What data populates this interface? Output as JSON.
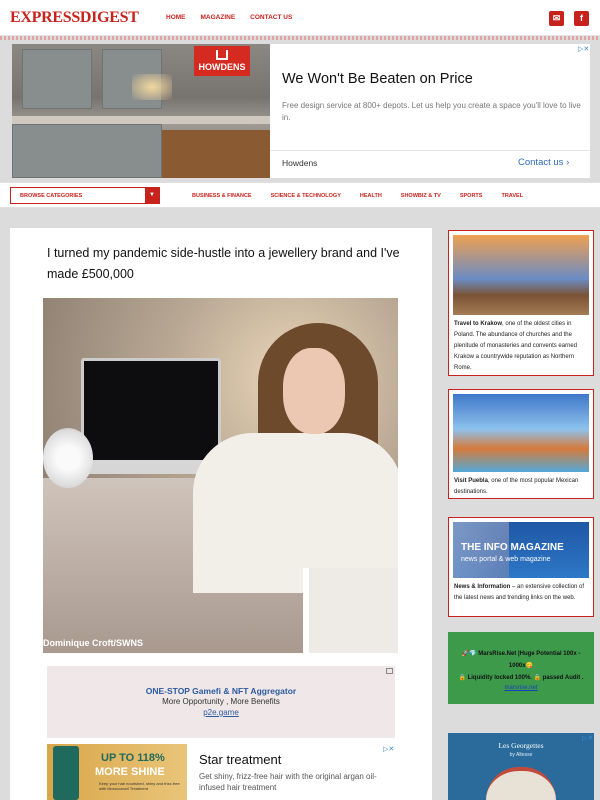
{
  "header": {
    "logo": "EXPRESSDIGEST",
    "nav": [
      "HOME",
      "MAGAZINE",
      "CONTACT US"
    ],
    "social": [
      "mail-icon",
      "facebook-icon"
    ]
  },
  "top_ad": {
    "logo_text": "HOWDENS",
    "title": "We Won't Be Beaten on Price",
    "description": "Free design service at 800+ depots. Let us help you create a space you'll love to live in.",
    "brand": "Howdens",
    "cta": "Contact us"
  },
  "category_bar": {
    "browse_label": "BROWSE CATEGORIES",
    "categories": [
      "BUSINESS & FINANCE",
      "SCIENCE & TECHNOLOGY",
      "HEALTH",
      "SHOWBIZ & TV",
      "SPORTS",
      "TRAVEL"
    ]
  },
  "article": {
    "headline": "I turned my pandemic side-hustle into a jewellery brand and I've made £500,000",
    "photo_credit": "Dominique Croft/SWNS"
  },
  "inline_ad": {
    "title": "ONE-STOP Gamefi & NFT Aggregator",
    "subtitle": "More Opportunity , More Benefits",
    "link": "p2e.game"
  },
  "product_ad": {
    "percent": "UP TO 118%",
    "shine": "MORE SHINE",
    "fine_print": "Keep your hair nourished, shiny and frizz-free with Moroccanoil Treatment",
    "title": "Star treatment",
    "description": "Get shiny, frizz-free hair with the original argan oil-infused hair treatment"
  },
  "sidebar": {
    "cards": [
      {
        "bold": "Travel to Krakow",
        "text": ", one of the oldest cities in Poland. The abundance of churches and the plenitude of monasteries and convents earned Krakow a countrywide reputation as Northern Rome."
      },
      {
        "bold": "Visit Puebla",
        "text": ", one of the most popular Mexican destinations."
      },
      {
        "bold": "News & Information",
        "text": " – an extensive collection of the latest news and trending links on the web.",
        "banner_title": "THE INFO MAGAZINE",
        "banner_sub": "news portal & web magazine"
      }
    ],
    "mars_ad": {
      "line1": "🚀💎 MarsRise.Net |Huge Potential 100x -",
      "line2": "1000x😋",
      "line3": "🔒 Liquidity locked 100%. 🔒 passed Audit .",
      "link": "marsrise.net"
    },
    "georgettes_ad": {
      "brand": "Les Georgettes",
      "sub": "by Altesse"
    }
  }
}
